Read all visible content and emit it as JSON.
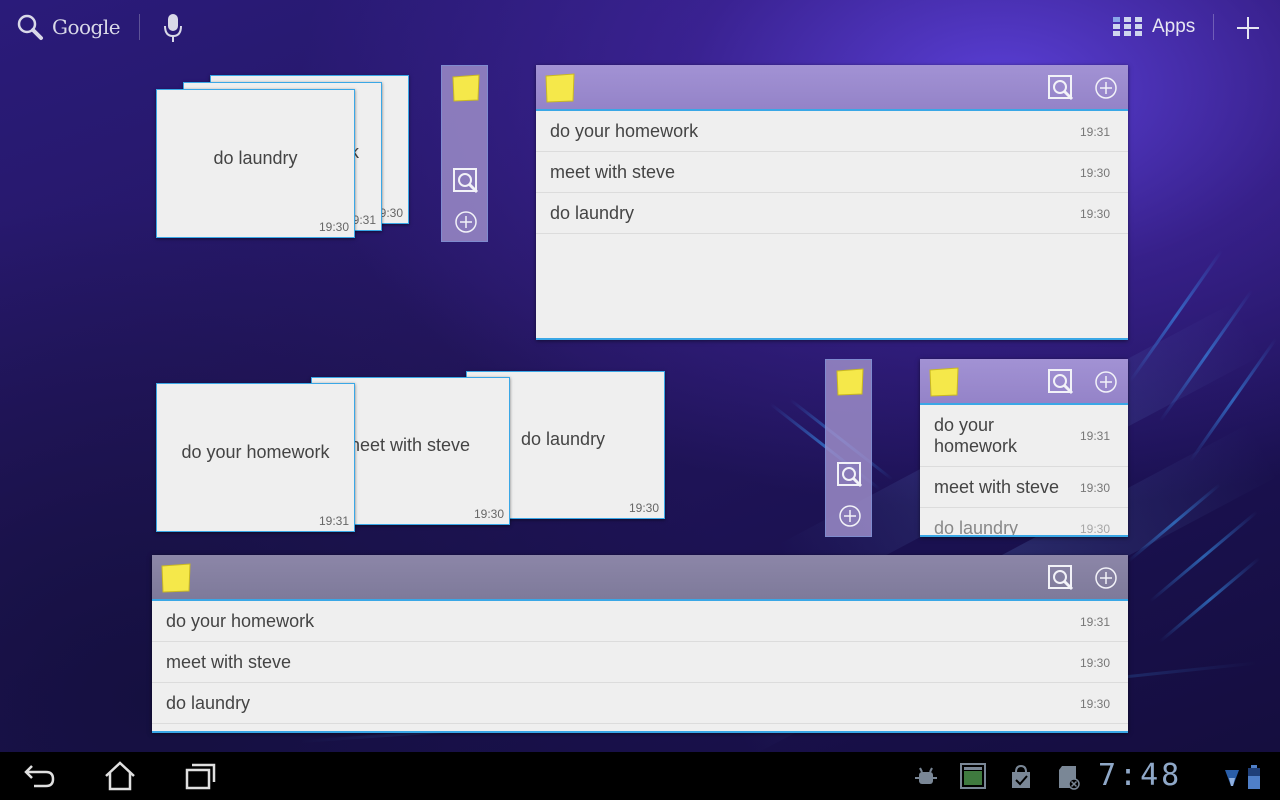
{
  "topbar": {
    "search_label": "Google",
    "apps_label": "Apps"
  },
  "stack_widget_1": {
    "cards": [
      {
        "text": "do laundry",
        "time": "19:30"
      },
      {
        "text": "k",
        "time": "19:31"
      },
      {
        "text": "",
        "time": "9:30"
      }
    ]
  },
  "list_widget_large": {
    "items": [
      {
        "text": "do your homework",
        "time": "19:31"
      },
      {
        "text": "meet with steve",
        "time": "19:30"
      },
      {
        "text": "do laundry",
        "time": "19:30"
      }
    ]
  },
  "stack_widget_2": {
    "cards": [
      {
        "text": "do your homework",
        "time": "19:31"
      },
      {
        "text": "neet with steve",
        "time": "19:30"
      },
      {
        "text": "do laundry",
        "time": "19:30"
      }
    ]
  },
  "list_widget_small": {
    "items": [
      {
        "text": "do your homework",
        "time": "19:31"
      },
      {
        "text": "meet with steve",
        "time": "19:30"
      },
      {
        "text": "do laundry",
        "time": "19:30"
      }
    ]
  },
  "list_widget_wide": {
    "items": [
      {
        "text": "do your homework",
        "time": "19:31"
      },
      {
        "text": "meet with steve",
        "time": "19:30"
      },
      {
        "text": "do laundry",
        "time": "19:30"
      }
    ]
  },
  "statusbar": {
    "clock": "7:48"
  },
  "colors": {
    "accent": "#3aa7e6",
    "widget_header": "#9a8acc",
    "sticky_note": "#f5e84a"
  }
}
